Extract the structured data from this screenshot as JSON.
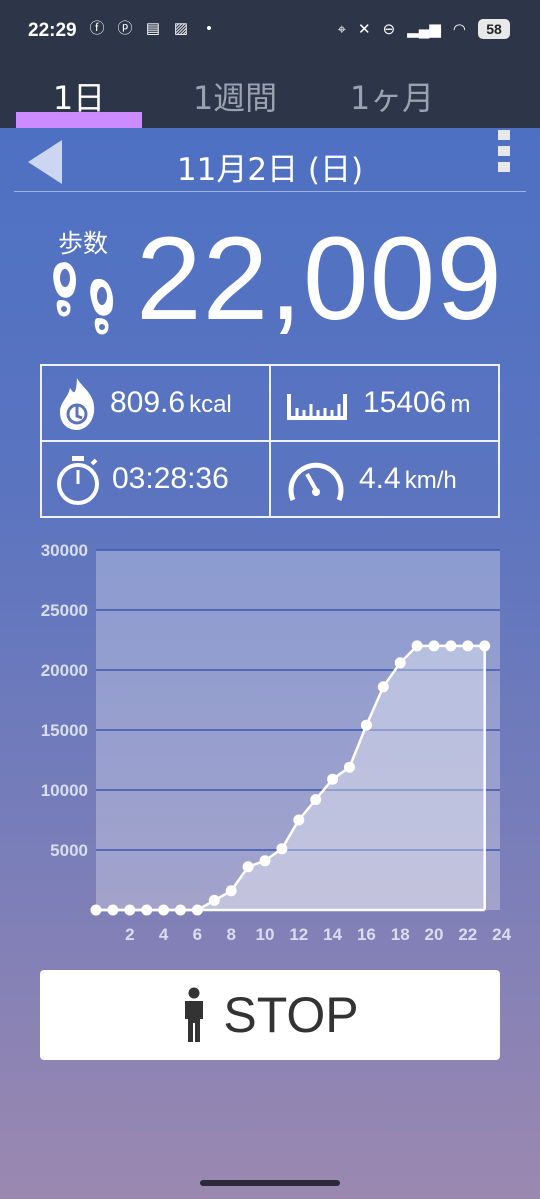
{
  "status_bar": {
    "time": "22:29",
    "battery": "58"
  },
  "tabs": [
    {
      "label": "1日",
      "active": true
    },
    {
      "label": "1週間",
      "active": false
    },
    {
      "label": "1ヶ月",
      "active": false
    }
  ],
  "date": "11月2日 (日)",
  "steps": {
    "label": "歩数",
    "value": "22,009"
  },
  "stats": {
    "calories": {
      "value": "809.6",
      "unit": "kcal"
    },
    "distance": {
      "value": "15406",
      "unit": "m"
    },
    "duration": {
      "value": "03:28:36"
    },
    "speed": {
      "value": "4.4",
      "unit": "km/h"
    }
  },
  "colors": {
    "tab_indicator": "#cc8cff",
    "header_bg": "#2c3648"
  },
  "chart_data": {
    "type": "area",
    "ylim": [
      0,
      30000
    ],
    "xlim": [
      0,
      24
    ],
    "y_ticks": [
      5000,
      10000,
      15000,
      20000,
      25000,
      30000
    ],
    "x_ticks": [
      2,
      4,
      6,
      8,
      10,
      12,
      14,
      16,
      18,
      20,
      22,
      24
    ],
    "grid": true,
    "x": [
      0,
      1,
      2,
      3,
      4,
      5,
      6,
      7,
      8,
      9,
      10,
      11,
      12,
      13,
      14,
      15,
      16,
      17,
      18,
      19,
      20,
      21,
      22,
      23
    ],
    "values": [
      0,
      0,
      0,
      0,
      0,
      0,
      0,
      800,
      1600,
      3600,
      4100,
      5100,
      7500,
      9200,
      10900,
      11900,
      15400,
      18600,
      20600,
      22009,
      22009,
      22009,
      22009,
      22009
    ]
  },
  "stop_button": {
    "label": "STOP",
    "icon": "person-standing-icon"
  }
}
